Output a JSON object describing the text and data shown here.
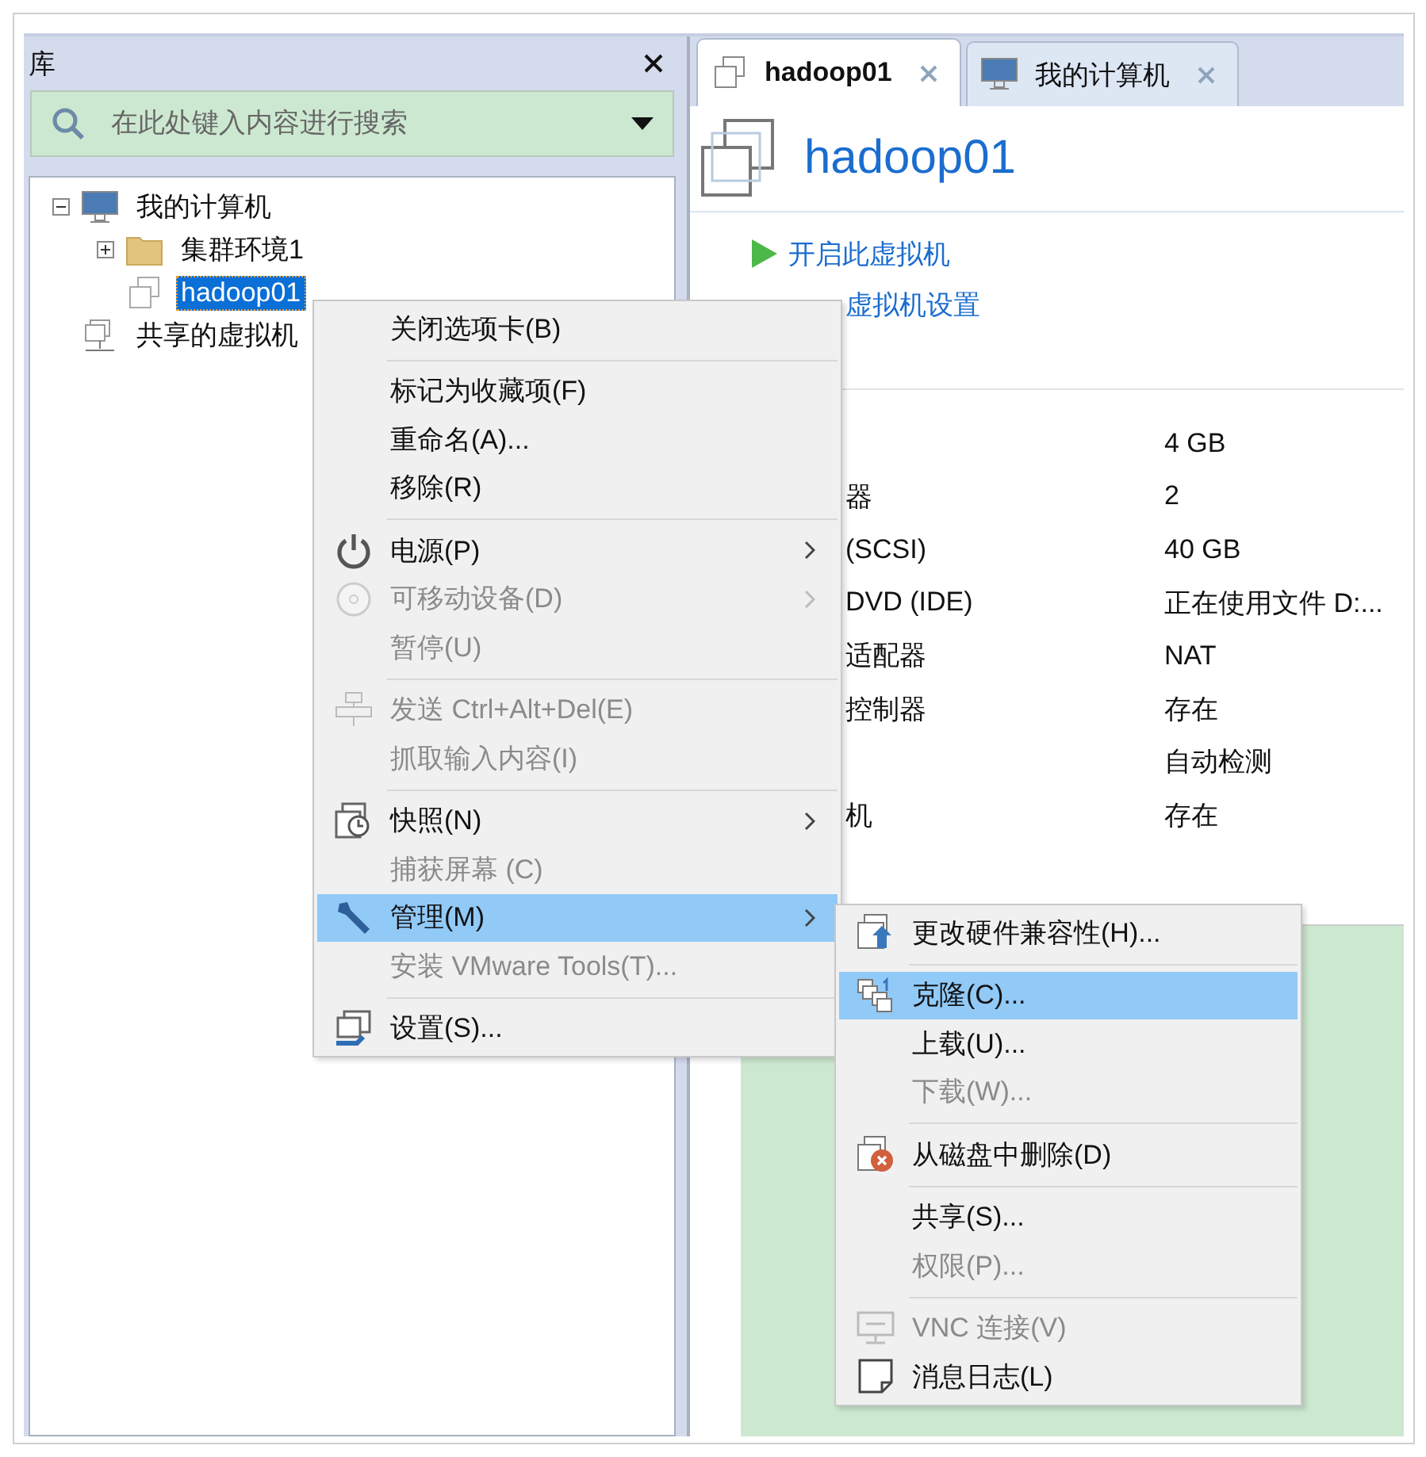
{
  "library": {
    "title": "库",
    "search": {
      "placeholder": "在此处键入内容进行搜索"
    },
    "tree": [
      {
        "label": "我的计算机",
        "kind": "computer",
        "expanded": true,
        "selected": false,
        "children": [
          {
            "label": "集群环境1",
            "kind": "folder",
            "expanded": false,
            "selected": false
          },
          {
            "label": "hadoop01",
            "kind": "vm",
            "selected": true
          }
        ]
      },
      {
        "label": "共享的虚拟机",
        "kind": "shared",
        "selected": false
      }
    ]
  },
  "tabs": [
    {
      "label": "hadoop01",
      "kind": "vm",
      "selected": true
    },
    {
      "label": "我的计算机",
      "kind": "computer",
      "selected": false
    }
  ],
  "vm": {
    "title": "hadoop01",
    "actions": [
      {
        "label": "开启此虚拟机",
        "kind": "play"
      },
      {
        "label": "虚拟机设置",
        "kind": "settings"
      }
    ],
    "devices": [
      {
        "value": "4 GB"
      },
      {
        "label": "器",
        "value": "2"
      },
      {
        "label": "(SCSI)",
        "value": "40 GB"
      },
      {
        "label": "DVD (IDE)",
        "value": "正在使用文件 D:..."
      },
      {
        "label": "适配器",
        "value": "NAT"
      },
      {
        "label": "控制器",
        "value": "存在"
      },
      {
        "value": "自动检测"
      },
      {
        "label": "机",
        "value": "存在"
      }
    ]
  },
  "context_menu": {
    "groups": [
      [
        {
          "label": "关闭选项卡(B)",
          "disabled": false,
          "selected": false,
          "submenu": false
        }
      ],
      [
        {
          "label": "标记为收藏项(F)",
          "disabled": false,
          "selected": false,
          "submenu": false
        },
        {
          "label": "重命名(A)...",
          "disabled": false,
          "selected": false,
          "submenu": false
        },
        {
          "label": "移除(R)",
          "disabled": false,
          "selected": false,
          "submenu": false
        }
      ],
      [
        {
          "label": "电源(P)",
          "kind": "power",
          "disabled": false,
          "selected": false,
          "submenu": true
        },
        {
          "label": "可移动设备(D)",
          "kind": "disc",
          "disabled": true,
          "selected": false,
          "submenu": true
        },
        {
          "label": "暂停(U)",
          "disabled": true,
          "selected": false,
          "submenu": false
        }
      ],
      [
        {
          "label": "发送 Ctrl+Alt+Del(E)",
          "kind": "network",
          "disabled": true,
          "selected": false,
          "submenu": false
        },
        {
          "label": "抓取输入内容(I)",
          "disabled": true,
          "selected": false,
          "submenu": false
        }
      ],
      [
        {
          "label": "快照(N)",
          "kind": "snapshot",
          "disabled": false,
          "selected": false,
          "submenu": true
        },
        {
          "label": "捕获屏幕 (C)",
          "disabled": true,
          "selected": false,
          "submenu": false
        },
        {
          "label": "管理(M)",
          "kind": "wrench",
          "disabled": false,
          "selected": true,
          "submenu": true
        },
        {
          "label": "安装 VMware Tools(T)...",
          "disabled": true,
          "selected": false,
          "submenu": false
        }
      ],
      [
        {
          "label": "设置(S)...",
          "kind": "settings",
          "disabled": false,
          "selected": false,
          "submenu": false
        }
      ]
    ]
  },
  "submenu": {
    "groups": [
      [
        {
          "label": "更改硬件兼容性(H)...",
          "kind": "upgrade",
          "disabled": false,
          "selected": false
        }
      ],
      [
        {
          "label": "克隆(C)...",
          "kind": "clone",
          "disabled": false,
          "selected": true
        },
        {
          "label": "上载(U)...",
          "disabled": false,
          "selected": false
        },
        {
          "label": "下载(W)...",
          "disabled": true,
          "selected": false
        }
      ],
      [
        {
          "label": "从磁盘中删除(D)",
          "kind": "delete",
          "disabled": false,
          "selected": false
        }
      ],
      [
        {
          "label": "共享(S)...",
          "disabled": false,
          "selected": false
        },
        {
          "label": "权限(P)...",
          "disabled": true,
          "selected": false
        }
      ],
      [
        {
          "label": "VNC 连接(V)",
          "kind": "vnc",
          "disabled": true,
          "selected": false
        },
        {
          "label": "消息日志(L)",
          "kind": "note",
          "disabled": false,
          "selected": false
        }
      ]
    ]
  }
}
